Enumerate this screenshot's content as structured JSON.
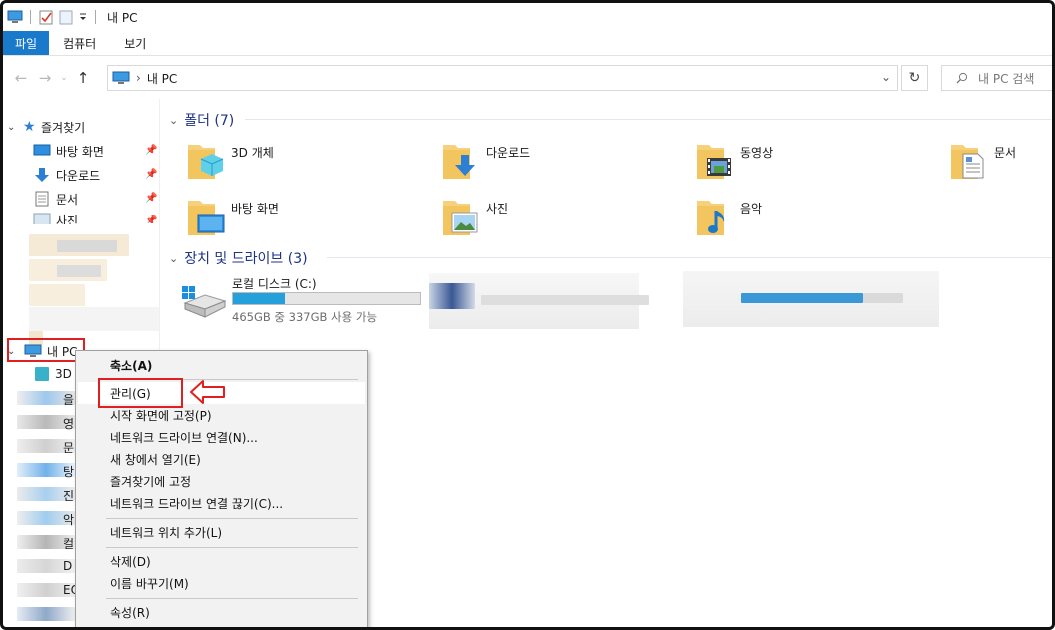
{
  "window": {
    "title": "내 PC"
  },
  "ribbon": {
    "tabs": [
      "파일",
      "컴퓨터",
      "보기"
    ]
  },
  "address": {
    "location": "내 PC",
    "separator": "›"
  },
  "search": {
    "placeholder": "내 PC 검색"
  },
  "sidebar": {
    "quick_access": "즐겨찾기",
    "pinned": [
      {
        "label": "바탕 화면",
        "icon": "desktop-icon"
      },
      {
        "label": "다운로드",
        "icon": "download-arrow-icon"
      },
      {
        "label": "문서",
        "icon": "document-icon"
      },
      {
        "label": "사진",
        "icon": "picture-icon"
      }
    ],
    "this_pc": "내 PC",
    "this_pc_child_fragments": [
      "3D",
      "을",
      "영",
      "문",
      "탕",
      "진",
      "악",
      "컬",
      "D",
      "EO"
    ]
  },
  "folders_section": {
    "heading": "폴더 (7)",
    "items": [
      {
        "label": "3D 개체",
        "icon": "3d-objects-folder-icon"
      },
      {
        "label": "다운로드",
        "icon": "downloads-folder-icon"
      },
      {
        "label": "동영상",
        "icon": "videos-folder-icon"
      },
      {
        "label": "문서",
        "icon": "documents-folder-icon"
      },
      {
        "label": "바탕 화면",
        "icon": "desktop-folder-icon"
      },
      {
        "label": "사진",
        "icon": "pictures-folder-icon"
      },
      {
        "label": "음악",
        "icon": "music-folder-icon"
      }
    ]
  },
  "drives_section": {
    "heading": "장치 및 드라이브 (3)",
    "drive": {
      "label": "로컬 디스크 (C:)",
      "free_text": "465GB 중 337GB 사용 가능",
      "used_fraction": 0.28
    }
  },
  "context_menu": {
    "items": [
      {
        "label": "축소(A)",
        "bold": true
      },
      {
        "label": "관리(G)",
        "highlight": true
      },
      {
        "label": "시작 화면에 고정(P)"
      },
      {
        "label": "네트워크 드라이브 연결(N)..."
      },
      {
        "label": "새 창에서 열기(E)"
      },
      {
        "label": "즐겨찾기에 고정"
      },
      {
        "label": "네트워크 드라이브 연결 끊기(C)..."
      },
      {
        "label": "네트워크 위치 추가(L)"
      },
      {
        "label": "삭제(D)"
      },
      {
        "label": "이름 바꾸기(M)"
      },
      {
        "label": "속성(R)"
      }
    ]
  },
  "colors": {
    "accent": "#1979ca",
    "annotation_red": "#e02020",
    "group_heading": "#1e3287",
    "drive_fill": "#26a0da"
  }
}
